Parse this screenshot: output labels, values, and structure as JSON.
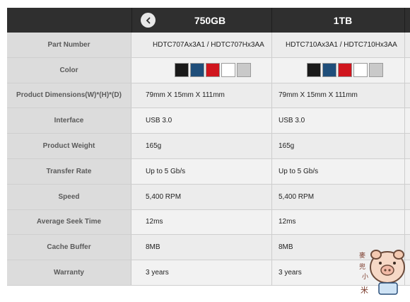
{
  "header": {
    "col1": "750GB",
    "col2": "1TB"
  },
  "colors": [
    "#1a1a1a",
    "#1f4e7a",
    "#d0161e",
    "#ffffff",
    "#c9c9c9"
  ],
  "rows": [
    {
      "label": "Part Number",
      "v1": "HDTC707Ax3A1 / HDTC707Hx3AA",
      "v2": "HDTC710Ax3A1 / HDTC710Hx3AA"
    },
    {
      "label": "Color",
      "v1": "",
      "v2": ""
    },
    {
      "label": "Product Dimensions(W)*(H)*(D)",
      "v1": "79mm X 15mm X 111mm",
      "v2": "79mm X 15mm X 111mm"
    },
    {
      "label": "Interface",
      "v1": "USB 3.0",
      "v2": "USB 3.0"
    },
    {
      "label": "Product Weight",
      "v1": "165g",
      "v2": "165g"
    },
    {
      "label": "Transfer Rate",
      "v1": "Up to 5 Gb/s",
      "v2": "Up to 5 Gb/s"
    },
    {
      "label": "Speed",
      "v1": "5,400 RPM",
      "v2": "5,400 RPM"
    },
    {
      "label": "Average Seek Time",
      "v1": "12ms",
      "v2": "12ms"
    },
    {
      "label": "Cache Buffer",
      "v1": "8MB",
      "v2": "8MB"
    },
    {
      "label": "Warranty",
      "v1": "3 years",
      "v2": "3 years"
    }
  ]
}
